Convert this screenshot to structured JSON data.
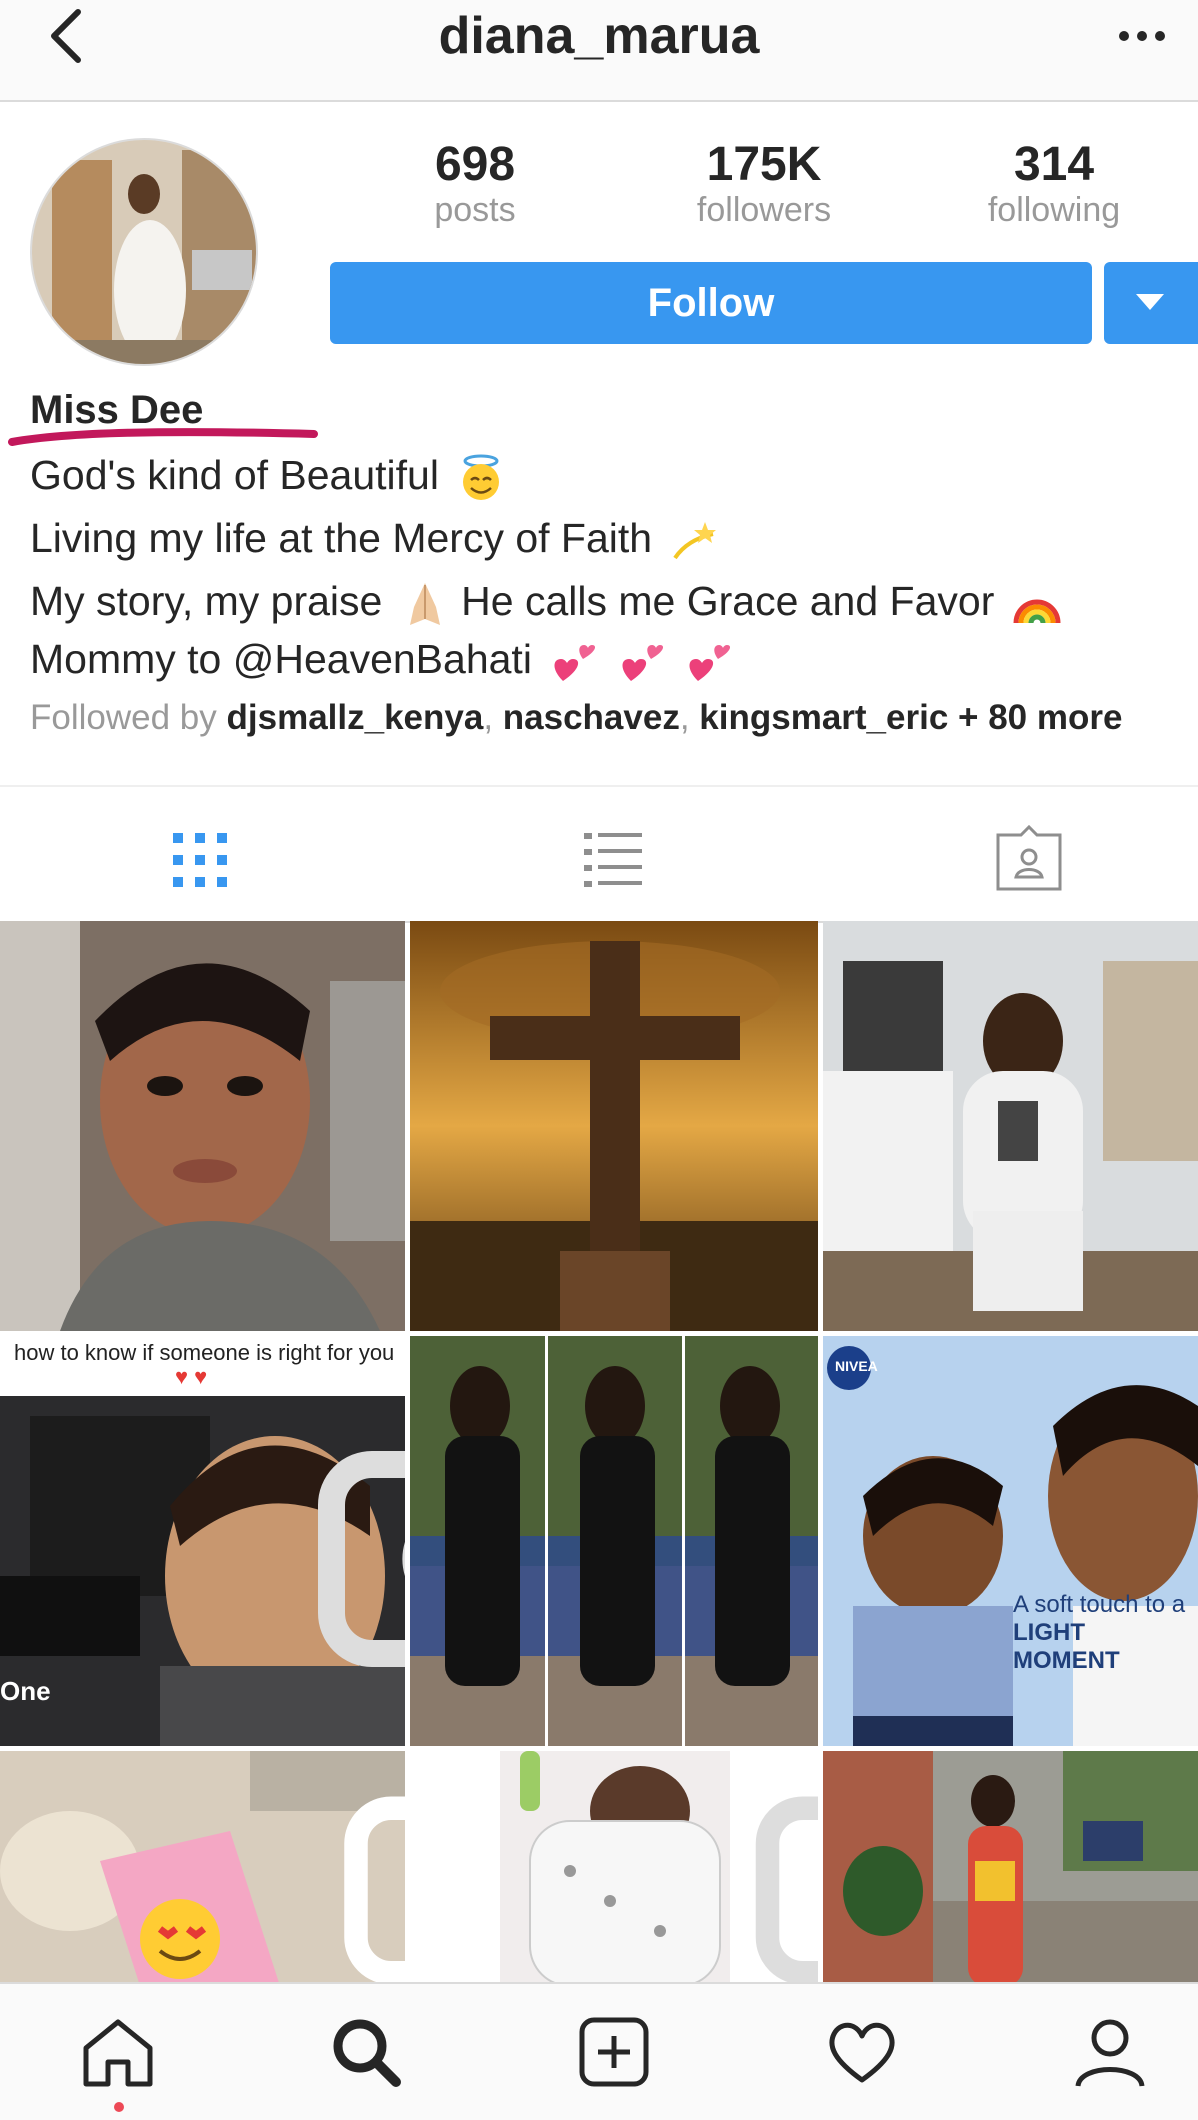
{
  "header": {
    "username": "diana_marua",
    "back_icon": "chevron-left-icon",
    "more_icon": "more-horizontal-icon"
  },
  "stats": [
    {
      "value": "698",
      "label": "posts"
    },
    {
      "value": "175K",
      "label": "followers"
    },
    {
      "value": "314",
      "label": "following"
    }
  ],
  "actions": {
    "follow_label": "Follow",
    "dropdown_icon": "triangle-down-icon"
  },
  "bio": {
    "full_name": "Miss Dee",
    "line1": "God's kind of Beautiful",
    "line2": "Living my life at the Mercy of Faith",
    "line3a": "My story, my praise",
    "line3b": "He calls me Grace and Favor",
    "line4": "Mommy to @HeavenBahati",
    "followed_prefix": "Followed by",
    "followers": [
      "djsmallz_kenya",
      "naschavez",
      "kingsmart_eric"
    ],
    "followed_more": "+ 80 more",
    "accent_color": "#c2185b"
  },
  "tabs": [
    {
      "name": "grid-icon",
      "active": true
    },
    {
      "name": "list-icon",
      "active": false
    },
    {
      "name": "tagged-icon",
      "active": false
    }
  ],
  "posts": [
    {
      "caption": ""
    },
    {
      "caption": ""
    },
    {
      "caption": ""
    },
    {
      "caption": "how to know if someone is right for you",
      "overlay": "One",
      "video": true
    },
    {
      "caption": ""
    },
    {
      "caption": "",
      "brand": "NIVEA",
      "overlay1": "A soft touch to a",
      "overlay2": "LIGHT MOMENT"
    },
    {
      "caption": "",
      "video": true
    },
    {
      "caption": "",
      "video": true
    },
    {
      "caption": ""
    }
  ],
  "bottom_nav": [
    "home-icon",
    "search-icon",
    "add-post-icon",
    "activity-heart-icon",
    "profile-icon"
  ],
  "colors": {
    "primary": "#3897f0",
    "text": "#262626",
    "muted": "#999999",
    "border": "#dbdbdb"
  }
}
